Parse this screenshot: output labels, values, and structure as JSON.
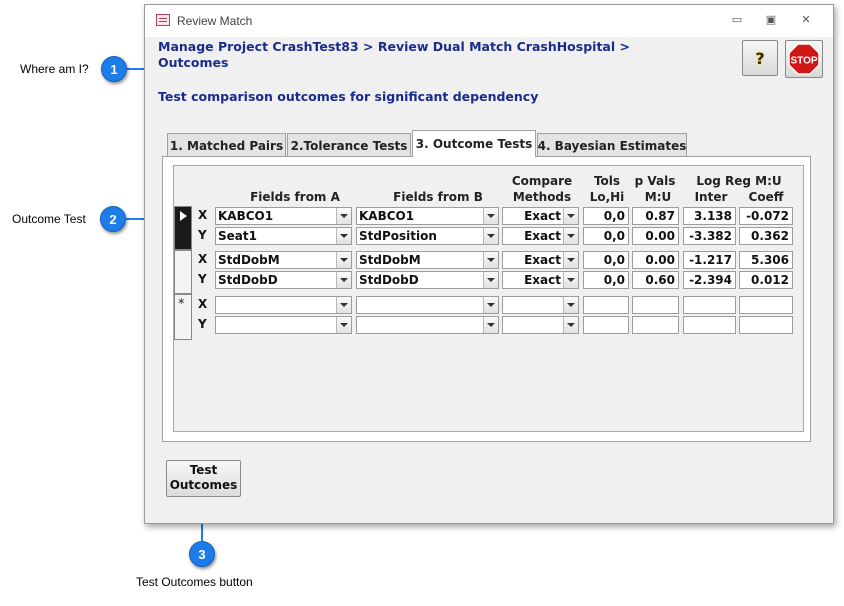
{
  "callouts": [
    {
      "number": "1",
      "label": "Where am I?"
    },
    {
      "number": "2",
      "label": "Outcome Test"
    },
    {
      "number": "3",
      "label": "Test Outcomes button"
    }
  ],
  "window": {
    "title": "Review Match",
    "controls": {
      "minimize": "▭",
      "restore": "▣",
      "close": "✕"
    }
  },
  "header": {
    "breadcrumb_line1": "Manage Project CrashTest83 > Review Dual Match CrashHospital >",
    "breadcrumb_line2": "Outcomes",
    "subtitle": "Test comparison outcomes for significant dependency",
    "help_label": "?",
    "stop_label": "STOP"
  },
  "tabs": [
    {
      "label": "1. Matched Pairs",
      "active": false
    },
    {
      "label": "2.Tolerance Tests",
      "active": false
    },
    {
      "label": "3. Outcome Tests",
      "active": true
    },
    {
      "label": "4. Bayesian Estimates",
      "active": false
    }
  ],
  "table": {
    "headers": {
      "fields_a": "Fields from A",
      "fields_b": "Fields from B",
      "compare_1": "Compare",
      "compare_2": "Methods",
      "tols_1": "Tols",
      "tols_2": "Lo,Hi",
      "pvals_1": "p Vals",
      "pvals_2": "M:U",
      "logreg_1": "Log Reg M:U",
      "inter": "Inter",
      "coeff": "Coeff"
    },
    "new_record_marker": "*",
    "records": [
      {
        "current": true,
        "rows": [
          {
            "axis": "X",
            "field_a": "KABCO1",
            "field_b": "KABCO1",
            "method": "Exact",
            "tol": "0,0",
            "pval": "0.87",
            "inter": "3.138",
            "coeff": "-0.072"
          },
          {
            "axis": "Y",
            "field_a": "Seat1",
            "field_b": "StdPosition",
            "method": "Exact",
            "tol": "0,0",
            "pval": "0.00",
            "inter": "-3.382",
            "coeff": "0.362"
          }
        ]
      },
      {
        "current": false,
        "rows": [
          {
            "axis": "X",
            "field_a": "StdDobM",
            "field_b": "StdDobM",
            "method": "Exact",
            "tol": "0,0",
            "pval": "0.00",
            "inter": "-1.217",
            "coeff": "5.306"
          },
          {
            "axis": "Y",
            "field_a": "StdDobD",
            "field_b": "StdDobD",
            "method": "Exact",
            "tol": "0,0",
            "pval": "0.60",
            "inter": "-2.394",
            "coeff": "0.012"
          }
        ]
      },
      {
        "current": false,
        "new": true,
        "rows": [
          {
            "axis": "X",
            "field_a": "",
            "field_b": "",
            "method": "",
            "tol": "",
            "pval": "",
            "inter": "",
            "coeff": ""
          },
          {
            "axis": "Y",
            "field_a": "",
            "field_b": "",
            "method": "",
            "tol": "",
            "pval": "",
            "inter": "",
            "coeff": ""
          }
        ]
      }
    ]
  },
  "buttons": {
    "test_outcomes_line1": "Test",
    "test_outcomes_line2": "Outcomes"
  },
  "colors": {
    "heading_text": "#1a2b8c",
    "callout_badge": "#1e7ce8",
    "stop_red": "#d01818"
  }
}
